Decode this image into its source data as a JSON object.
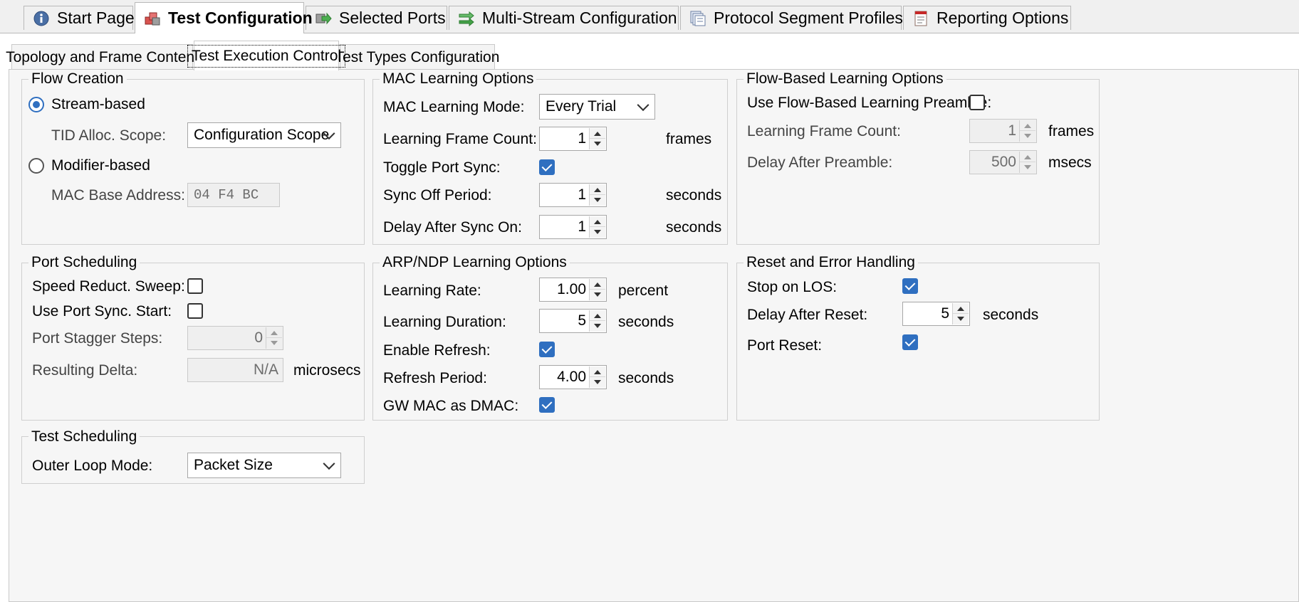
{
  "top_tabs": [
    {
      "label": "Start Page",
      "icon": "info-icon"
    },
    {
      "label": "Test Configuration",
      "icon": "cubes-icon"
    },
    {
      "label": "Selected Ports",
      "icon": "ports-arrow-icon"
    },
    {
      "label": "Multi-Stream Configuration",
      "icon": "multi-stream-icon"
    },
    {
      "label": "Protocol Segment Profiles",
      "icon": "document-stack-icon"
    },
    {
      "label": "Reporting Options",
      "icon": "report-icon"
    }
  ],
  "sub_tabs": [
    {
      "label": "Topology and Frame Content"
    },
    {
      "label": "Test Execution Control"
    },
    {
      "label": "Test Types Configuration"
    }
  ],
  "flow_creation": {
    "title": "Flow Creation",
    "stream_based_label": "Stream-based",
    "tid_scope_label": "TID Alloc. Scope:",
    "tid_scope_value": "Configuration Scope",
    "modifier_based_label": "Modifier-based",
    "mac_base_label": "MAC Base Address:",
    "mac_base_value": "04 F4 BC"
  },
  "mac_learning": {
    "title": "MAC Learning Options",
    "mode_label": "MAC Learning Mode:",
    "mode_value": "Every Trial",
    "frame_count_label": "Learning Frame Count:",
    "frame_count_value": "1",
    "frame_count_unit": "frames",
    "toggle_sync_label": "Toggle Port Sync:",
    "sync_off_label": "Sync Off Period:",
    "sync_off_value": "1",
    "sync_off_unit": "seconds",
    "delay_sync_label": "Delay After Sync On:",
    "delay_sync_value": "1",
    "delay_sync_unit": "seconds"
  },
  "flow_learning": {
    "title": "Flow-Based Learning Options",
    "preamble_label": "Use Flow-Based Learning Preamble:",
    "frame_count_label": "Learning Frame Count:",
    "frame_count_value": "1",
    "frame_count_unit": "frames",
    "delay_label": "Delay After Preamble:",
    "delay_value": "500",
    "delay_unit": "msecs"
  },
  "port_scheduling": {
    "title": "Port Scheduling",
    "speed_label": "Speed Reduct. Sweep:",
    "sync_start_label": "Use Port Sync. Start:",
    "stagger_label": "Port Stagger Steps:",
    "stagger_value": "0",
    "delta_label": "Resulting Delta:",
    "delta_value": "N/A",
    "delta_unit": "microsecs"
  },
  "arp_learning": {
    "title": "ARP/NDP Learning Options",
    "rate_label": "Learning Rate:",
    "rate_value": "1.00",
    "rate_unit": "percent",
    "duration_label": "Learning Duration:",
    "duration_value": "5",
    "duration_unit": "seconds",
    "refresh_label": "Enable Refresh:",
    "period_label": "Refresh Period:",
    "period_value": "4.00",
    "period_unit": "seconds",
    "gw_label": "GW MAC as DMAC:"
  },
  "reset_handling": {
    "title": "Reset and Error Handling",
    "los_label": "Stop on LOS:",
    "delay_label": "Delay After Reset:",
    "delay_value": "5",
    "delay_unit": "seconds",
    "port_reset_label": "Port Reset:"
  },
  "test_scheduling": {
    "title": "Test Scheduling",
    "outer_label": "Outer Loop Mode:",
    "outer_value": "Packet Size"
  },
  "state": {
    "stream_based_selected": true,
    "modifier_based_selected": false,
    "toggle_port_sync": true,
    "flow_preamble": false,
    "speed_sweep": false,
    "port_sync_start": false,
    "enable_refresh": true,
    "gw_mac_dmac": true,
    "stop_on_los": true,
    "port_reset": true
  },
  "colors": {
    "accent": "#2f6fc0",
    "panel": "#f6f6f6"
  }
}
